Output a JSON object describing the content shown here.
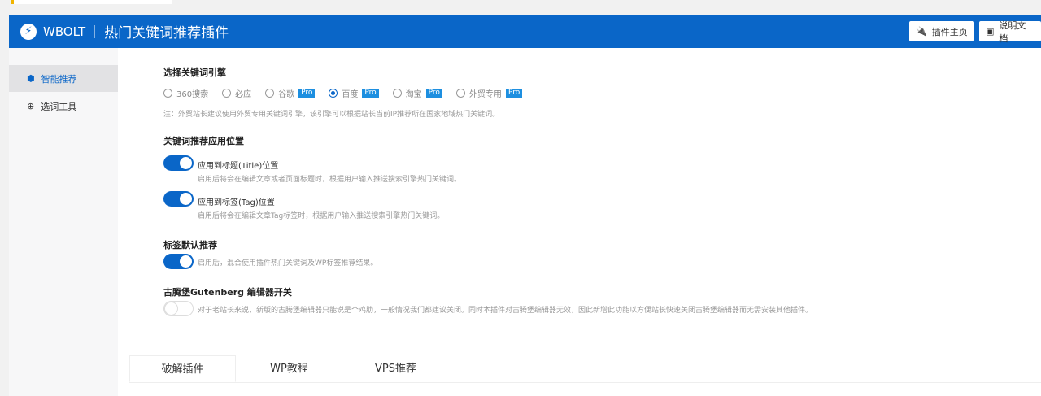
{
  "header": {
    "brand": "WBOLT",
    "title": "热门关键词推荐插件",
    "buttons": [
      {
        "label": "插件主页",
        "icon": "plug-icon"
      },
      {
        "label": "说明文档",
        "icon": "document-icon"
      }
    ]
  },
  "sidebar": {
    "items": [
      {
        "label": "智能推荐",
        "icon": "cube-icon",
        "active": true
      },
      {
        "label": "选词工具",
        "icon": "crosshair-icon",
        "active": false
      }
    ]
  },
  "engine": {
    "heading": "选择关键词引擎",
    "options": [
      {
        "label": "360搜索",
        "pro": false,
        "selected": false
      },
      {
        "label": "必应",
        "pro": false,
        "selected": false
      },
      {
        "label": "谷歌",
        "pro": true,
        "selected": false
      },
      {
        "label": "百度",
        "pro": true,
        "selected": true
      },
      {
        "label": "淘宝",
        "pro": true,
        "selected": false
      },
      {
        "label": "外贸专用",
        "pro": true,
        "selected": false
      }
    ],
    "pro_badge": "Pro",
    "note": "注：外贸站长建议使用外贸专用关键词引擎，该引擎可以根据站长当前IP推荐所在国家地域热门关键词。"
  },
  "position": {
    "heading": "关键词推荐应用位置",
    "title_toggle": {
      "label": "应用到标题(Title)位置",
      "desc": "启用后将会在编辑文章或者页面标题时，根据用户输入推送搜索引擎热门关键词。",
      "on": true
    },
    "tag_toggle": {
      "label": "应用到标签(Tag)位置",
      "desc": "启用后将会在编辑文章Tag标签时，根据用户输入推送搜索引擎热门关键词。",
      "on": true
    }
  },
  "tag_default": {
    "heading": "标签默认推荐",
    "desc": "启用后，混合使用插件热门关键词及WP标签推荐结果。",
    "on": true
  },
  "gutenberg": {
    "heading": "古腾堡Gutenberg 编辑器开关",
    "desc": "对于老站长来说，新版的古腾堡编辑器只能说是个鸡肋，一般情况我们都建议关闭。同时本插件对古腾堡编辑器无效，因此新增此功能以方便站长快速关闭古腾堡编辑器而无需安装其他插件。",
    "on": false
  },
  "tabs": [
    {
      "label": "破解插件",
      "active": true
    },
    {
      "label": "WP教程",
      "active": false
    },
    {
      "label": "VPS推荐",
      "active": false
    }
  ],
  "colors": {
    "accent": "#0a66c8",
    "pro": "#1d8fe0"
  }
}
